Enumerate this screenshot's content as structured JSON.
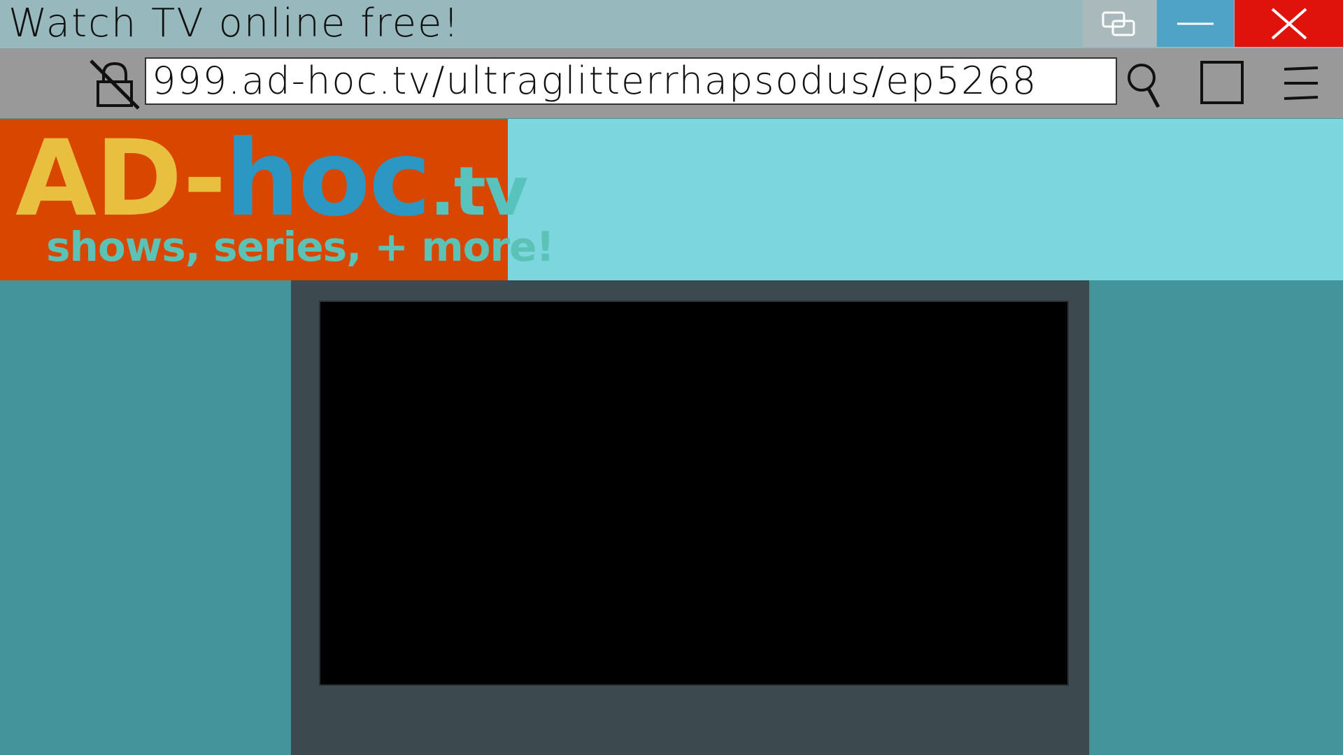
{
  "window": {
    "title": "Watch TV online free!",
    "controls": {
      "restore_icon": "restore-windows-icon",
      "minimize_icon": "minimize-icon",
      "close_icon": "close-x-icon"
    }
  },
  "browser": {
    "lock_icon": "lock-broken-icon",
    "url": "999.ad-hoc.tv/ultraglitterrhapsodus/ep5268",
    "search_icon": "search-icon",
    "tab_icon": "tab-square-icon",
    "menu_icon": "hamburger-menu-icon"
  },
  "site": {
    "logo_ad": "AD-",
    "logo_hoc": "hoc",
    "logo_tv": ".tv",
    "tagline": "shows, series, + more!"
  },
  "colors": {
    "close_red": "#e0120c",
    "minimize_blue": "#4ea3c6",
    "logo_orange": "#d84600",
    "header_cyan": "#7bd6dd",
    "page_teal": "#44959b"
  }
}
